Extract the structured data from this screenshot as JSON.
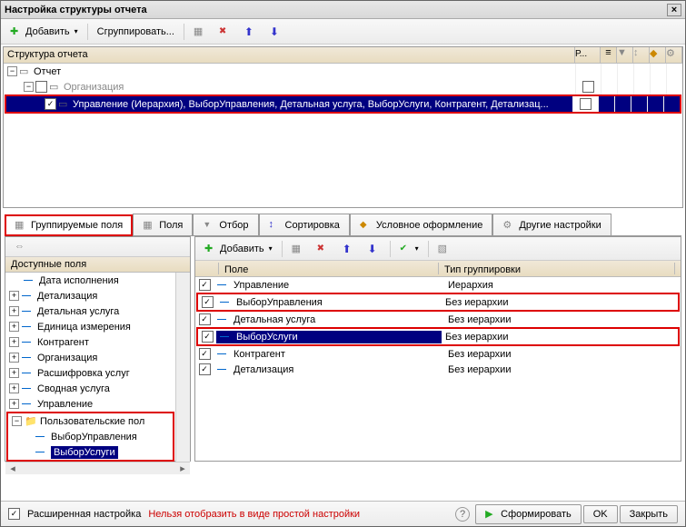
{
  "title": "Настройка структуры отчета",
  "toolbar": {
    "add": "Добавить",
    "group": "Сгруппировать..."
  },
  "struct": {
    "header": "Структура отчета",
    "colR": "Р...",
    "root": "Отчет",
    "row1": "Организация",
    "row2": "Управление (Иерархия), ВыборУправления, Детальная услуга, ВыборУслуги, Контрагент, Детализац..."
  },
  "tabs": {
    "groupFields": "Группируемые поля",
    "fields": "Поля",
    "filter": "Отбор",
    "sort": "Сортировка",
    "cond": "Условное оформление",
    "other": "Другие настройки"
  },
  "availHeader": "Доступные поля",
  "avail": [
    "Дата исполнения",
    "Детализация",
    "Детальная услуга",
    "Единица измерения",
    "Контрагент",
    "Организация",
    "Расшифровка услуг",
    "Сводная услуга",
    "Управление"
  ],
  "userFields": {
    "label": "Пользовательские пол",
    "i1": "ВыборУправления",
    "i2": "ВыборУслуги"
  },
  "rightToolbar": {
    "add": "Добавить"
  },
  "rightHeader": {
    "field": "Поле",
    "type": "Тип группировки"
  },
  "rows": [
    {
      "f": "Управление",
      "t": "Иерархия",
      "hl": false
    },
    {
      "f": "ВыборУправления",
      "t": "Без иерархии",
      "hl": true
    },
    {
      "f": "Детальная услуга",
      "t": "Без иерархии",
      "hl": false
    },
    {
      "f": "ВыборУслуги",
      "t": "Без иерархии",
      "hl": true,
      "sel": true
    },
    {
      "f": "Контрагент",
      "t": "Без иерархии",
      "hl": false
    },
    {
      "f": "Детализация",
      "t": "Без иерархии",
      "hl": false
    }
  ],
  "footer": {
    "adv": "Расширенная настройка",
    "warn": "Нельзя отобразить в виде простой настройки",
    "form": "Сформировать",
    "ok": "OK",
    "close": "Закрыть"
  }
}
